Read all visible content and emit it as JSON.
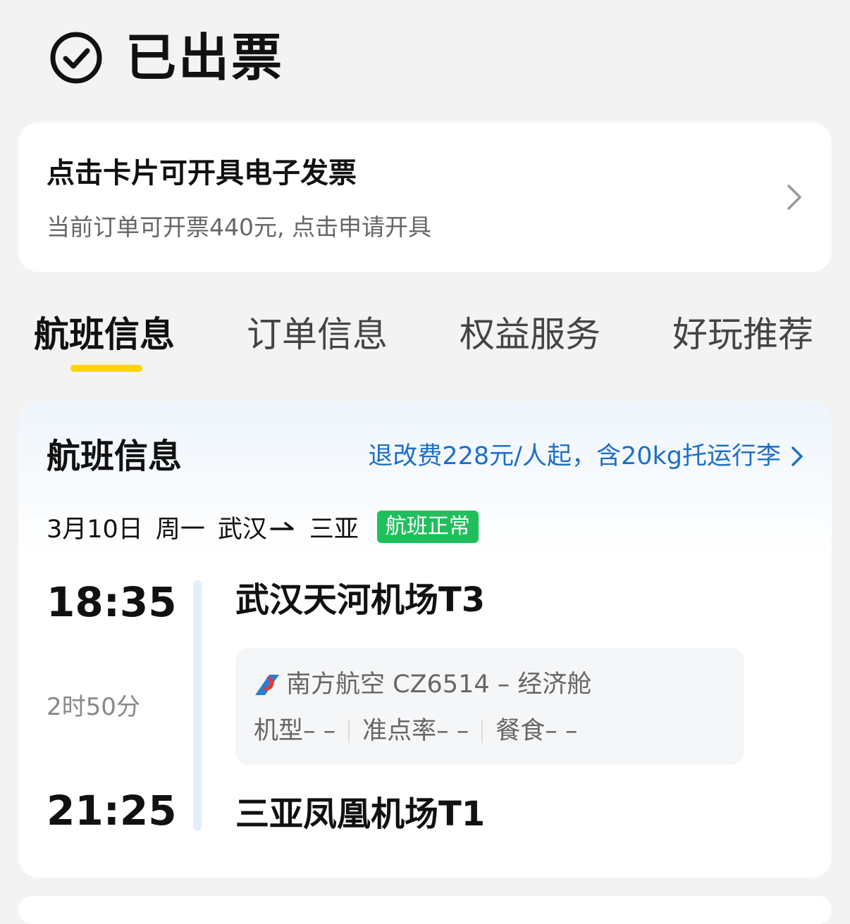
{
  "header": {
    "status": "已出票",
    "icon": "check-circle-icon"
  },
  "invoice": {
    "title": "点击卡片可开具电子发票",
    "subtitle": "当前订单可开票440元, 点击申请开具",
    "chevron_icon": "chevron-right-icon"
  },
  "tabs": [
    {
      "label": "航班信息",
      "active": true
    },
    {
      "label": "订单信息",
      "active": false
    },
    {
      "label": "权益服务",
      "active": false
    },
    {
      "label": "好玩推荐",
      "active": false
    }
  ],
  "colors": {
    "accent": "#ffd400",
    "link": "#1d6fc8",
    "status_ok": "#1fbf5c"
  },
  "flight": {
    "section_title": "航班信息",
    "refund_note": "退改费228元/人起，含20kg托运行李",
    "date": "3月10日",
    "weekday": "周一",
    "from_city": "武汉",
    "to_city": "三亚",
    "status": "航班正常",
    "departure_time": "18:35",
    "arrival_time": "21:25",
    "duration": "2时50分",
    "departure_airport": "武汉天河机场T3",
    "arrival_airport": "三亚凤凰机场T1",
    "airline": "南方航空 CZ6514 – 经济舱",
    "aircraft": "机型– –",
    "on_time_rate": "准点率– –",
    "meal": "餐食– –"
  }
}
